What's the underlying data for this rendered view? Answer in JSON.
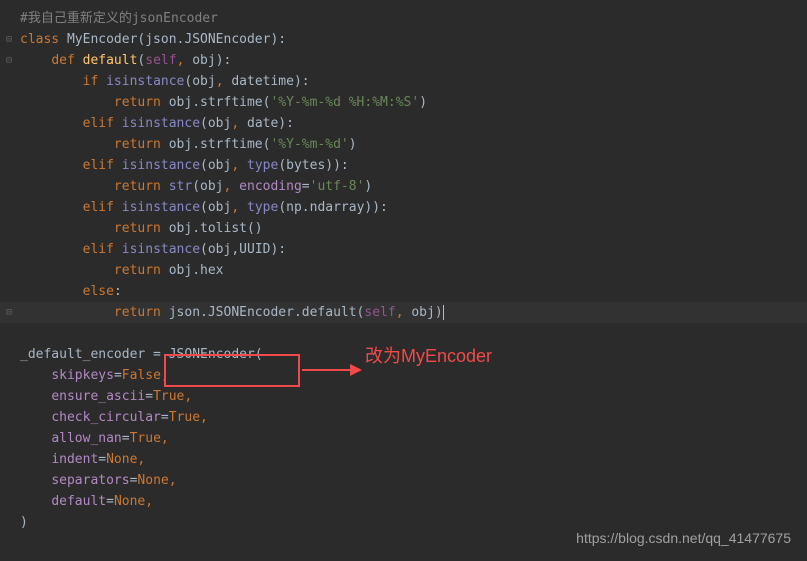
{
  "code": {
    "l1": "#我自己重新定义的jsonEncoder",
    "l2_class": "class",
    "l2_name": " MyEncoder(json.JSONEncoder):",
    "l3_def": "def",
    "l3_name": " default",
    "l3_paren_open": "(",
    "l3_self": "self",
    "l3_comma": ", ",
    "l3_obj": "obj",
    "l3_close": "):",
    "l4_if": "if",
    "l4_isinstance": " isinstance",
    "l4_args": "(obj",
    "l4_comma": ", ",
    "l4_datetime": "datetime):",
    "l5_return": "return",
    "l5_expr": " obj.strftime(",
    "l5_str": "'%Y-%m-%d %H:%M:%S'",
    "l5_close": ")",
    "l6_elif": "elif",
    "l6_isinstance": " isinstance",
    "l6_args": "(obj",
    "l6_comma": ", ",
    "l6_date": "date):",
    "l7_return": "return",
    "l7_expr": " obj.strftime(",
    "l7_str": "'%Y-%m-%d'",
    "l7_close": ")",
    "l8_elif": "elif",
    "l8_isinstance": " isinstance",
    "l8_args": "(obj",
    "l8_comma": ", ",
    "l8_type": "type",
    "l8_bytes": "(bytes",
    "l8_close": ")):",
    "l9_return": "return",
    "l9_str": " str",
    "l9_args": "(obj",
    "l9_comma": ", ",
    "l9_encoding": "encoding",
    "l9_eq": "=",
    "l9_utf": "'utf-8'",
    "l9_close": ")",
    "l10_elif": "elif",
    "l10_isinstance": " isinstance",
    "l10_args": "(obj",
    "l10_comma": ", ",
    "l10_type": "type",
    "l10_np": "(np.ndarray)):",
    "l11_return": "return",
    "l11_expr": " obj.tolist()",
    "l12_elif": "elif",
    "l12_isinstance": " isinstance",
    "l12_args": "(obj,UUID):",
    "l13_return": "return",
    "l13_expr": " obj.hex",
    "l14_else": "else",
    "l14_colon": ":",
    "l15_return": "return",
    "l15_expr": " json.JSONEncoder.default(",
    "l15_self": "self",
    "l15_comma": ", ",
    "l15_obj": "obj",
    "l15_close": ")",
    "l17_var": "_default_encoder = ",
    "l17_enc": "JSONEncoder(",
    "l18_key": "skipkeys",
    "l18_eq": "=",
    "l18_val": "False",
    "l18_comma": ",",
    "l19_key": "ensure_ascii",
    "l19_eq": "=",
    "l19_val": "True",
    "l19_comma": ",",
    "l20_key": "check_circular",
    "l20_eq": "=",
    "l20_val": "True",
    "l20_comma": ",",
    "l21_key": "allow_nan",
    "l21_eq": "=",
    "l21_val": "True",
    "l21_comma": ",",
    "l22_key": "indent",
    "l22_eq": "=",
    "l22_val": "None",
    "l22_comma": ",",
    "l23_key": "separators",
    "l23_eq": "=",
    "l23_val": "None",
    "l23_comma": ",",
    "l24_key": "default",
    "l24_eq": "=",
    "l24_val": "None",
    "l24_comma": ",",
    "l25_close": ")"
  },
  "annotation": {
    "text": "改为MyEncoder"
  },
  "watermark": "https://blog.csdn.net/qq_41477675"
}
